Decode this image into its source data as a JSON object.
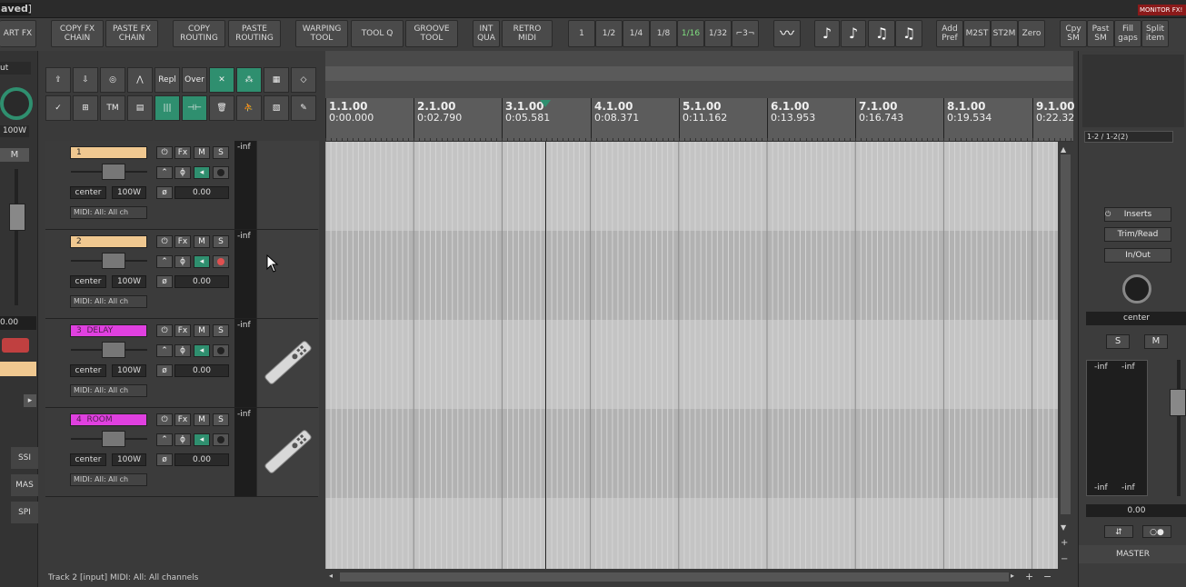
{
  "window": {
    "title_fragment": "aved]",
    "monitor_badge": "MONITOR FX!"
  },
  "toolbar": {
    "start_fx": "ART FX",
    "copy_fx_chain": [
      "COPY FX",
      "CHAIN"
    ],
    "paste_fx_chain": [
      "PASTE FX",
      "CHAIN"
    ],
    "copy_routing": [
      "COPY",
      "ROUTING"
    ],
    "paste_routing": [
      "PASTE",
      "ROUTING"
    ],
    "warping_tool": [
      "WARPING",
      "TOOL"
    ],
    "tool_q": "TOOL Q",
    "groove_tool": [
      "GROOVE",
      "TOOL"
    ],
    "int_qua": [
      "INT",
      "QUA"
    ],
    "retro_midi": [
      "RETRO",
      "MIDI"
    ],
    "grid": [
      "1",
      "1/2",
      "1/4",
      "1/8",
      "1/16",
      "1/32",
      "⌐3¬"
    ],
    "grid_active": "1/16",
    "add_pref": [
      "Add",
      "Pref"
    ],
    "m2st": "M2ST",
    "st2m": "ST2M",
    "zero": "Zero",
    "cpy_sm": [
      "Cpy",
      "SM"
    ],
    "past_sm": [
      "Past",
      "SM"
    ],
    "fill_gaps": [
      "Fill",
      "gaps"
    ],
    "split_item": [
      "Split",
      "item"
    ]
  },
  "icon_grid": {
    "repl": "Repl",
    "over": "Over",
    "tm": "TM"
  },
  "left_strip": {
    "out_label": "ut",
    "vol": "100W",
    "m": "M",
    "db": "0.00",
    "buttons": [
      "SSI",
      "MAS",
      "SPI"
    ]
  },
  "tracks": [
    {
      "num": "1",
      "name": "",
      "color": "tan",
      "pan": "center",
      "width": "100W",
      "vol": "0.00",
      "midi": "MIDI: All: All ch",
      "meter": "-inf",
      "armed": false
    },
    {
      "num": "2",
      "name": "",
      "color": "tan",
      "pan": "center",
      "width": "100W",
      "vol": "0.00",
      "midi": "MIDI: All: All ch",
      "meter": "-inf",
      "armed": true
    },
    {
      "num": "3",
      "name": "DELAY",
      "color": "pink",
      "pan": "center",
      "width": "100W",
      "vol": "0.00",
      "midi": "MIDI: All: All ch",
      "meter": "-inf",
      "armed": false
    },
    {
      "num": "4",
      "name": "ROOM",
      "color": "pink",
      "pan": "center",
      "width": "100W",
      "vol": "0.00",
      "midi": "MIDI: All: All ch",
      "meter": "-inf",
      "armed": false
    }
  ],
  "track_buttons": {
    "fx": "Fx",
    "m": "M",
    "s": "S"
  },
  "ruler": [
    {
      "bar": "1.1.00",
      "time": "0:00.000"
    },
    {
      "bar": "2.1.00",
      "time": "0:02.790"
    },
    {
      "bar": "3.1.00",
      "time": "0:05.581"
    },
    {
      "bar": "4.1.00",
      "time": "0:08.371"
    },
    {
      "bar": "5.1.00",
      "time": "0:11.162"
    },
    {
      "bar": "6.1.00",
      "time": "0:13.953"
    },
    {
      "bar": "7.1.00",
      "time": "0:16.743"
    },
    {
      "bar": "8.1.00",
      "time": "0:19.534"
    },
    {
      "bar": "9.1.00",
      "time": "0:22.32"
    }
  ],
  "status": "Track 2 [input] MIDI: All: All channels",
  "mixer": {
    "io": "1-2 / 1-2(2)",
    "inserts": "Inserts",
    "trim_read": "Trim/Read",
    "in_out": "In/Out",
    "pan": "center",
    "s": "S",
    "m": "M",
    "meter_l": "-inf",
    "meter_r": "-inf",
    "meter_lb": "-inf",
    "meter_rb": "-inf",
    "vol": "0.00",
    "name": "MASTER"
  }
}
